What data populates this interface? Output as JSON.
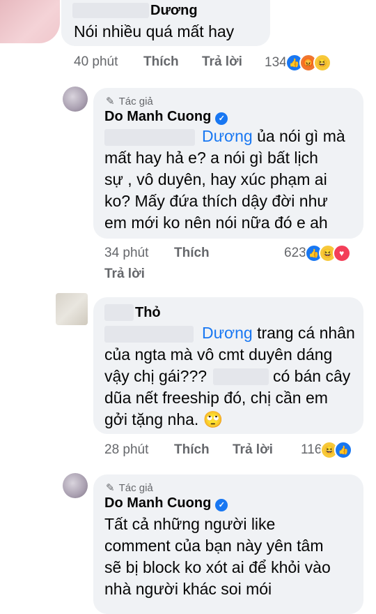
{
  "comments": [
    {
      "author": "Dương",
      "text": "Nói nhiều quá mất hay",
      "time": "40 phút",
      "like": "Thích",
      "reply": "Trả lời",
      "reaction_count": "134",
      "reactions": [
        "like-icon",
        "angry-icon",
        "haha-icon"
      ]
    },
    {
      "author_badge": "Tác giả",
      "author": "Do Manh Cuong",
      "mention": "Dương",
      "text_rest": " ủa nói gì mà",
      "lines": [
        "mất hay hả e? a nói gì bất lịch",
        "sự , vô duyên, hay xúc phạm ai",
        "ko? Mấy đứa thích dậy đời như",
        "em mới ko nên nói nữa đó e ah"
      ],
      "time": "34 phút",
      "like": "Thích",
      "reply": "Trả lời",
      "reaction_count": "623",
      "reactions": [
        "like-icon",
        "haha-icon",
        "love-icon"
      ]
    },
    {
      "author": "Thỏ",
      "mention": "Dương",
      "text_rest": " trang cá nhân",
      "lines": [
        "của ngta mà vô cmt duyên dáng",
        "vậy chị gái???",
        "có bán cây",
        "dũa nết freeship đó, chị cần em",
        "gởi tặng nha."
      ],
      "emoji": "🙄",
      "time": "28 phút",
      "like": "Thích",
      "reply": "Trả lời",
      "reaction_count": "116",
      "reactions": [
        "haha-icon",
        "like-icon"
      ]
    },
    {
      "author_badge": "Tác giả",
      "author": "Do Manh Cuong",
      "lines": [
        "Tất cả những người like",
        "comment của bạn này yên tâm",
        "sẽ bị block ko xót ai để khỏi vào",
        "nhà người khác soi mói"
      ]
    }
  ]
}
